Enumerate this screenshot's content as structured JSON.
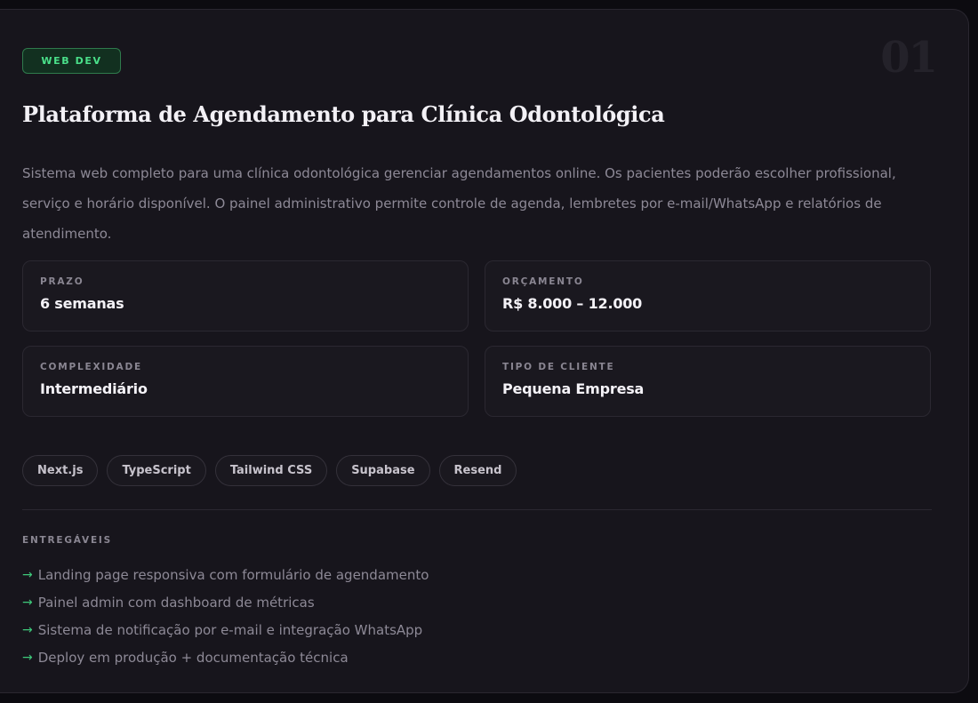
{
  "card": {
    "badge": "WEB DEV",
    "number": "01",
    "title": "Plataforma de Agendamento para Clínica Odontológica",
    "description": "Sistema web completo para uma clínica odontológica gerenciar agendamentos online. Os pacientes poderão escolher profissional, serviço e horário disponível. O painel administrativo permite controle de agenda, lembretes por e-mail/WhatsApp e relatórios de atendimento.",
    "stats": [
      {
        "label": "PRAZO",
        "value": "6 semanas"
      },
      {
        "label": "ORÇAMENTO",
        "value": "R$ 8.000 – 12.000"
      },
      {
        "label": "COMPLEXIDADE",
        "value": "Intermediário"
      },
      {
        "label": "TIPO DE CLIENTE",
        "value": "Pequena Empresa"
      }
    ],
    "tags": [
      "Next.js",
      "TypeScript",
      "Tailwind CSS",
      "Supabase",
      "Resend"
    ],
    "deliverables_heading": "ENTREGÁVEIS",
    "deliverables_arrow": "→",
    "deliverables": [
      "Landing page responsiva com formulário de agendamento",
      "Painel admin com dashboard de métricas",
      "Sistema de notificação por e-mail e integração WhatsApp",
      "Deploy em produção + documentação técnica"
    ]
  },
  "colors": {
    "background": "#0c0b10",
    "card": "#17151c",
    "accent": "#4ae08a",
    "badge_bg": "#123020",
    "text": "#f3f1f6",
    "muted": "#8d8996"
  }
}
